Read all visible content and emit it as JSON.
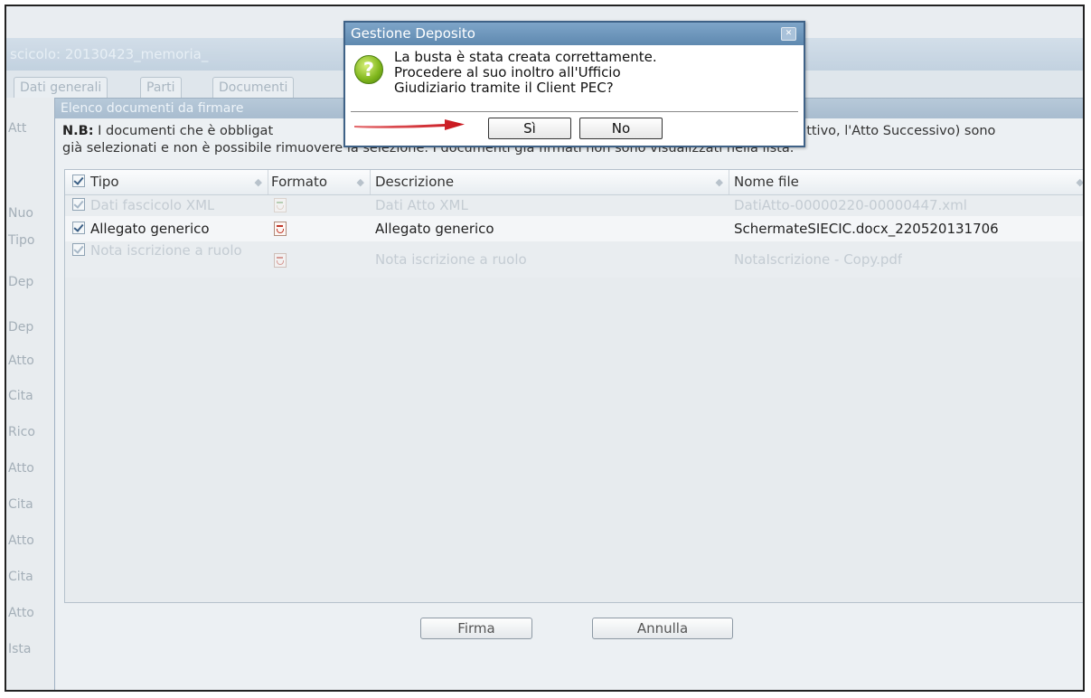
{
  "background": {
    "window_title": "scicolo: 20130423_memoria_",
    "tabs": [
      "Dati generali",
      "Parti",
      "Documenti"
    ],
    "sidebar_items": [
      "Att",
      "Nuo",
      "Tipo",
      "Dep",
      "Dep",
      "Atto",
      "Cita",
      "Rico",
      "Atto",
      "Cita",
      "Atto",
      "Cita",
      "Atto",
      "Ista"
    ]
  },
  "main_dialog": {
    "title": "Elenco documenti da firmare",
    "note": {
      "bold": "N.B:",
      "line1": " I documenti che è obbligat",
      "line1_end": "uttivo, l'Atto Successivo) sono",
      "line2": "già selezionati e non è possibile rimuovere la selezione. I documenti già firmati non sono visualizzati nella lista."
    },
    "grid": {
      "headers": {
        "tipo": "Tipo",
        "formato": "Formato",
        "descrizione": "Descrizione",
        "nome_file": "Nome file"
      },
      "rows": [
        {
          "tipo": "Dati fascicolo XML",
          "formato_icon": "xml-file-icon",
          "descrizione": "Dati Atto XML",
          "nome_file": "DatiAtto-00000220-00000447.xml",
          "state": "disabled"
        },
        {
          "tipo": "Allegato generico",
          "formato_icon": "pdf-file-icon",
          "descrizione": "Allegato generico",
          "nome_file": "SchermateSIECIC.docx_220520131706",
          "state": "active"
        },
        {
          "tipo": "Nota iscrizione a ruolo",
          "formato_icon": "pdf-file-icon",
          "descrizione": "Nota iscrizione a ruolo",
          "nome_file": "NotaIscrizione - Copy.pdf",
          "state": "disabled"
        }
      ]
    },
    "buttons": {
      "firma": "Firma",
      "annulla": "Annulla"
    }
  },
  "modal": {
    "title": "Gestione Deposito",
    "close_icon": "close-icon",
    "icon": "question-icon",
    "message_lines": [
      "La busta è stata creata correttamente.",
      "Procedere al suo inoltro all'Ufficio",
      "Giudiziario tramite il Client PEC?"
    ],
    "yes_label": "Sì",
    "no_label": "No"
  },
  "colors": {
    "modal_title_bg": "#6f97bd",
    "arrow": "#d9262b",
    "main_title_bg": "#b0c3d5"
  }
}
